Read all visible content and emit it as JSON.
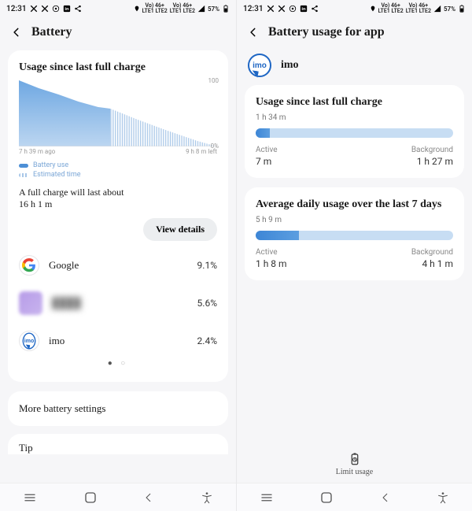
{
  "status": {
    "time": "12:31",
    "battery_pct": "57%",
    "net1": "Vo) 46+",
    "net1b": "LTE1 LTE2",
    "net2": "Vo) 46+",
    "net2b": "LTE1 LTE2"
  },
  "left": {
    "title": "Battery",
    "section_title": "Usage since last full charge",
    "chart_x_left": "7 h 39 m ago",
    "chart_x_right": "9 h 8 m left",
    "chart_y_top": "100",
    "chart_y_bottom": "0%",
    "legend_use": "Battery use",
    "legend_est": "Estimated time",
    "full_charge_line1": "A full charge will last about",
    "full_charge_line2": "16 h 1 m",
    "view_details": "View details",
    "apps": [
      {
        "name": "Google",
        "pct": "9.1%",
        "icon": "google"
      },
      {
        "name": "Hidden",
        "pct": "5.6%",
        "icon": "blur"
      },
      {
        "name": "imo",
        "pct": "2.4%",
        "icon": "imo"
      }
    ],
    "more_settings": "More battery settings",
    "tip": "Tip"
  },
  "right": {
    "title": "Battery usage for app",
    "app_name": "imo",
    "sect1_title": "Usage since last full charge",
    "sect1_total": "1 h 34 m",
    "sect1_active_lbl": "Active",
    "sect1_active_val": "7 m",
    "sect1_bg_lbl": "Background",
    "sect1_bg_val": "1 h 27 m",
    "sect1_fill_pct": 7,
    "sect2_title": "Average daily usage over the last 7 days",
    "sect2_total": "5 h 9 m",
    "sect2_active_lbl": "Active",
    "sect2_active_val": "1 h 8 m",
    "sect2_bg_lbl": "Background",
    "sect2_bg_val": "4 h 1 m",
    "sect2_fill_pct": 22,
    "limit_usage": "Limit usage"
  },
  "chart_data": {
    "type": "area",
    "title": "Usage since last full charge",
    "xlabel_left": "7 h 39 m ago",
    "xlabel_right": "9 h 8 m left",
    "ylabel": "",
    "ylim": [
      0,
      100
    ],
    "series": [
      {
        "name": "Battery use",
        "x_pct": [
          0,
          10,
          20,
          30,
          40,
          46
        ],
        "values": [
          100,
          88,
          78,
          68,
          60,
          57
        ]
      },
      {
        "name": "Estimated time",
        "x_pct": [
          46,
          60,
          75,
          90,
          100
        ],
        "values": [
          57,
          40,
          24,
          8,
          0
        ]
      }
    ],
    "battery_now_pct": 57,
    "full_charge_estimate": "16 h 1 m"
  }
}
